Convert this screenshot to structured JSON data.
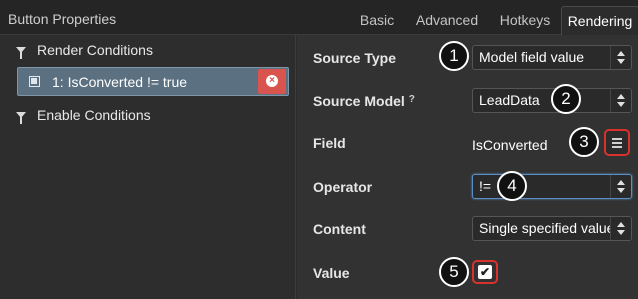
{
  "panel": {
    "title": "Button Properties"
  },
  "tabs": [
    {
      "label": "Basic"
    },
    {
      "label": "Advanced"
    },
    {
      "label": "Hotkeys"
    },
    {
      "label": "Rendering",
      "active": true
    }
  ],
  "left": {
    "render_conditions": "Render Conditions",
    "condition_item": "1: IsConverted != true",
    "enable_conditions": "Enable Conditions"
  },
  "form": {
    "source_type": {
      "label": "Source Type",
      "value": "Model field value"
    },
    "source_model": {
      "label": "Source Model",
      "value": "LeadData",
      "help": "?"
    },
    "field": {
      "label": "Field",
      "value": "IsConverted"
    },
    "operator": {
      "label": "Operator",
      "value": "!="
    },
    "content": {
      "label": "Content",
      "value": "Single specified value"
    },
    "value": {
      "label": "Value",
      "checked": true,
      "check": "✔"
    }
  },
  "callouts": [
    "1",
    "2",
    "3",
    "4",
    "5"
  ],
  "colors": {
    "accent_red": "#d9312b",
    "condition_bg": "#5b7081",
    "remove_red": "#d9534f",
    "focus_blue": "#5a8fc5"
  },
  "icons": {
    "funnel": "filter-icon",
    "cube": "model-cube-icon",
    "remove": "remove-circle-icon",
    "list": "field-list-icon",
    "check": "checkbox-check-icon"
  }
}
